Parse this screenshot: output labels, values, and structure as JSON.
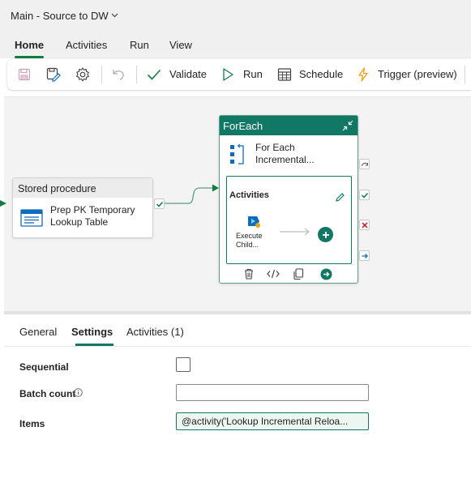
{
  "title_bar": {
    "title": "Main - Source to DW",
    "dropdown_icon": "chevron-down-icon"
  },
  "menu": {
    "tabs": [
      "Home",
      "Activities",
      "Run",
      "View"
    ],
    "active_tab": "Home"
  },
  "toolbar": {
    "validate_label": "Validate",
    "run_label": "Run",
    "schedule_label": "Schedule",
    "trigger_label": "Trigger (preview)",
    "icons": [
      "save-icon",
      "save-as-icon",
      "settings-gear-icon",
      "undo-icon",
      "validate-check-icon",
      "run-play-icon",
      "schedule-calendar-icon",
      "trigger-lightning-icon"
    ]
  },
  "canvas": {
    "stored_procedure": {
      "type_label": "Stored procedure",
      "name": "Prep PK Temporary Lookup Table"
    },
    "foreach": {
      "header": "ForEach",
      "name": "For Each Incremental...",
      "inner_title": "Activities",
      "inner_activity_label": "Execute Child..."
    }
  },
  "tabs": {
    "items": [
      "General",
      "Settings",
      "Activities (1)"
    ],
    "active": "Settings"
  },
  "settings": {
    "sequential_label": "Sequential",
    "sequential_checked": false,
    "batch_count_label": "Batch count",
    "batch_count_value": "",
    "items_label": "Items",
    "items_value": "@activity('Lookup Incremental Reloa..."
  },
  "colors": {
    "accent": "#117865",
    "success": "#107c41",
    "error": "#c50f1f"
  }
}
